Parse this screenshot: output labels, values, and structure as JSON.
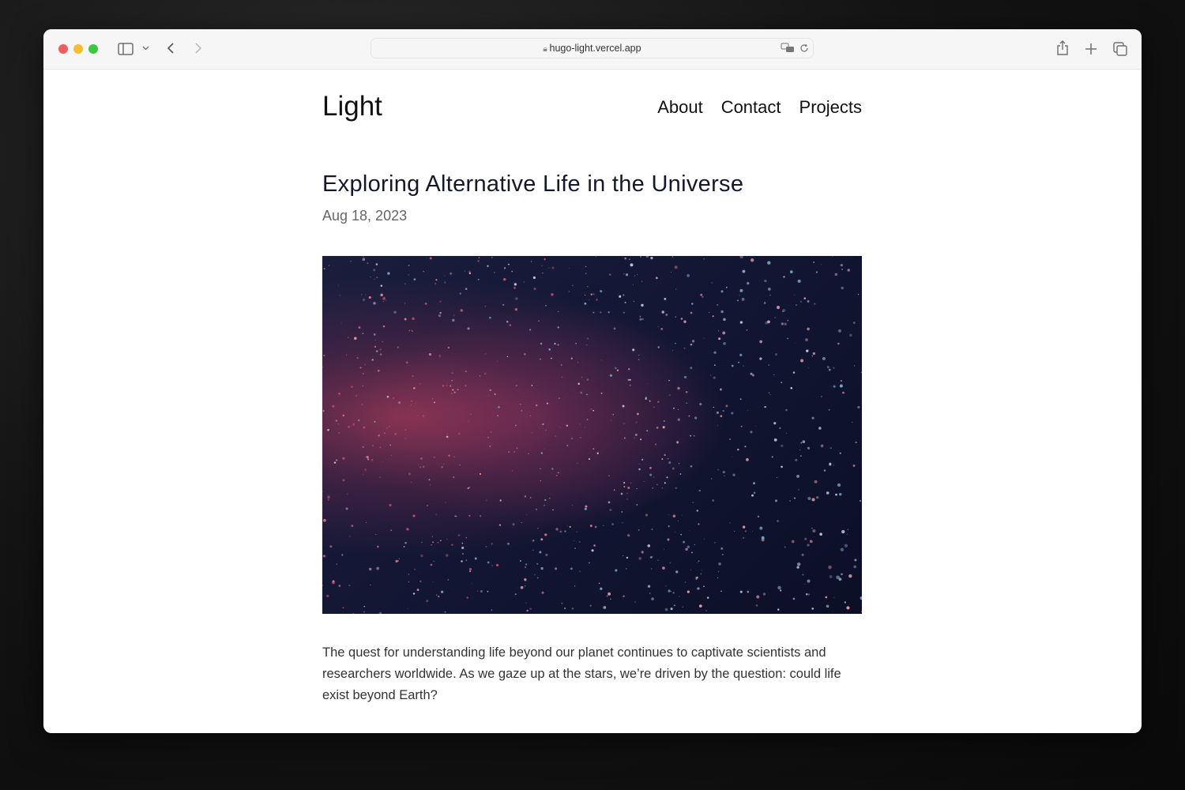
{
  "browser": {
    "url": "hugo-light.vercel.app",
    "icons": [
      "close-dot",
      "minimize-dot",
      "zoom-dot",
      "sidebar-icon",
      "chevron-down-icon",
      "back-icon",
      "forward-icon",
      "lock-icon",
      "translate-icon",
      "reload-icon",
      "share-icon",
      "new-tab-icon",
      "tabs-overview-icon"
    ],
    "colors": {
      "close": "#ee5f5b",
      "minimize": "#f5bd30",
      "zoom": "#3dc841"
    }
  },
  "site": {
    "logo": "Light",
    "nav": [
      "About",
      "Contact",
      "Projects"
    ]
  },
  "post": {
    "title": "Exploring Alternative Life in the Universe",
    "date": "Aug 18, 2023",
    "paragraph": "The quest for understanding life beyond our planet continues to captivate scientists and researchers worldwide. As we gaze up at the stars, we’re driven by the question: could life exist beyond Earth?"
  }
}
